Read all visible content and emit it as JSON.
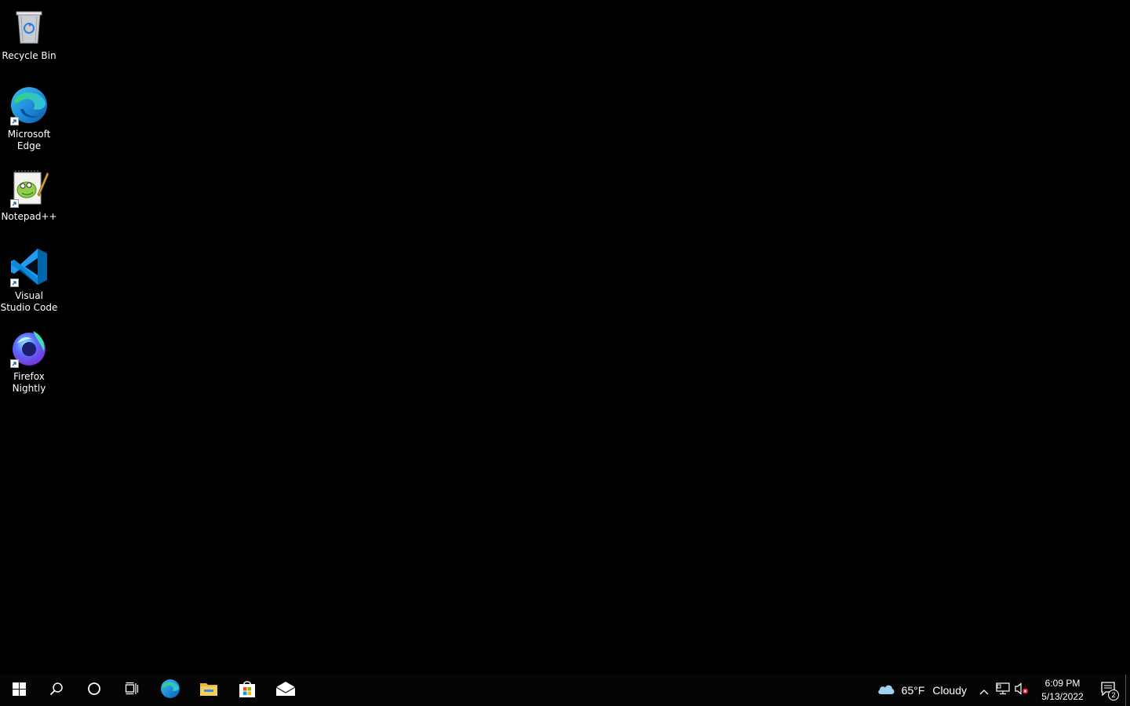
{
  "desktop": {
    "background": "#000000",
    "icons": [
      {
        "label": "Recycle Bin",
        "icon": "recycle-bin-icon"
      },
      {
        "label": "Microsoft Edge",
        "icon": "edge-icon"
      },
      {
        "label": "Notepad++",
        "icon": "notepadpp-icon"
      },
      {
        "label": "Visual Studio Code",
        "icon": "vscode-icon"
      },
      {
        "label": "Firefox Nightly",
        "icon": "firefox-nightly-icon"
      }
    ]
  },
  "taskbar": {
    "background": "#050505",
    "buttons": [
      {
        "name": "start",
        "icon": "windows-logo-icon"
      },
      {
        "name": "search",
        "icon": "search-icon"
      },
      {
        "name": "cortana",
        "icon": "cortana-circle-icon"
      },
      {
        "name": "task-view",
        "icon": "task-view-icon"
      }
    ],
    "pinned_apps": [
      {
        "name": "Microsoft Edge",
        "icon": "edge-icon"
      },
      {
        "name": "File Explorer",
        "icon": "folder-icon"
      },
      {
        "name": "Microsoft Store",
        "icon": "store-icon"
      },
      {
        "name": "Mail",
        "icon": "mail-icon"
      }
    ],
    "tray": {
      "weather": {
        "temp": "65°F",
        "condition": "Cloudy",
        "icon": "cloud-icon"
      },
      "icons": [
        "chevron-up-icon",
        "network-icon",
        "volume-muted-icon"
      ],
      "clock": {
        "time": "6:09 PM",
        "date": "5/13/2022"
      },
      "notifications": {
        "count": "2",
        "icon": "action-center-icon"
      }
    }
  }
}
